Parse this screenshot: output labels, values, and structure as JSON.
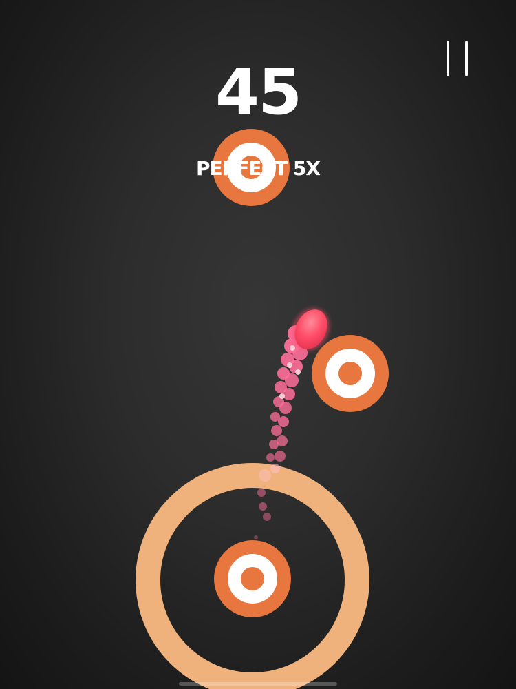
{
  "hud": {
    "score": "45",
    "combo_text": "PERFECT 5X"
  },
  "colors": {
    "target_orange": "#e8763f",
    "target_white": "#ffffff",
    "ring_peach": "#efb27c",
    "ball_red": "#ff4c66",
    "trail_pink": "#ff6f9a",
    "background": "#2b2b2b"
  },
  "icons": {
    "pause": "pause-icon"
  }
}
